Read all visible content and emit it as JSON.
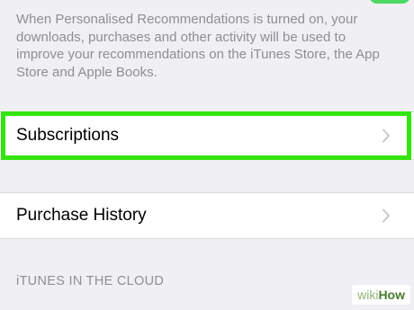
{
  "toggle": {
    "state": "on",
    "color": "#4cd964"
  },
  "footer_note": "When Personalised Recommendations is turned on, your downloads, purchases and other activity will be used to improve your recommendations on the iTunes Store, the App Store and Apple Books.",
  "rows": {
    "subscriptions": {
      "label": "Subscriptions",
      "icon": "chevron-right-icon",
      "highlighted": true
    },
    "purchase_history": {
      "label": "Purchase History",
      "icon": "chevron-right-icon"
    }
  },
  "section_header": "iTUNES IN THE CLOUD",
  "highlight_color": "#33e40f",
  "watermark": {
    "part1": "wiki",
    "part2": "How"
  }
}
